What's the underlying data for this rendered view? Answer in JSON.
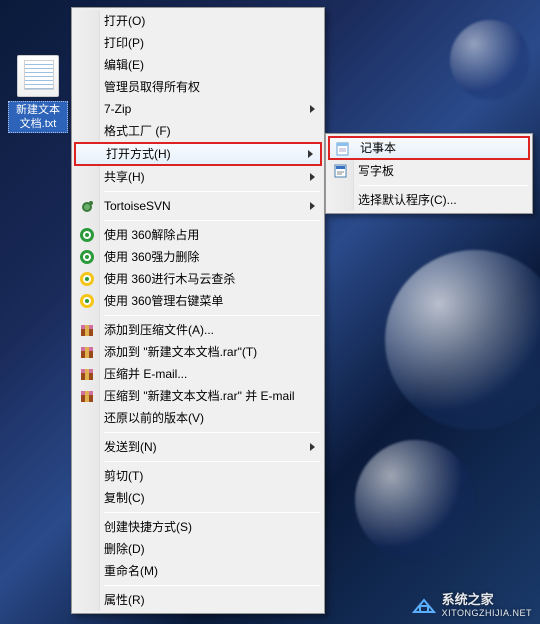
{
  "desktop": {
    "file_label": "新建文本文档.txt"
  },
  "menu": {
    "items": [
      {
        "label": "打开(O)",
        "submenu": false
      },
      {
        "label": "打印(P)",
        "submenu": false
      },
      {
        "label": "编辑(E)",
        "submenu": false
      },
      {
        "label": "管理员取得所有权",
        "submenu": false
      },
      {
        "label": "7-Zip",
        "submenu": true
      },
      {
        "label": "格式工厂 (F)",
        "submenu": false
      },
      {
        "label": "打开方式(H)",
        "submenu": true,
        "highlight": true
      },
      {
        "label": "共享(H)",
        "submenu": true
      },
      {
        "label": "TortoiseSVN",
        "submenu": true,
        "icon": "tortoise"
      },
      {
        "label": "使用 360解除占用",
        "submenu": false,
        "icon": "360"
      },
      {
        "label": "使用 360强力删除",
        "submenu": false,
        "icon": "360"
      },
      {
        "label": "使用 360进行木马云查杀",
        "submenu": false,
        "icon": "360y"
      },
      {
        "label": "使用 360管理右键菜单",
        "submenu": false,
        "icon": "360y"
      },
      {
        "label": "添加到压缩文件(A)...",
        "submenu": false,
        "icon": "rar"
      },
      {
        "label": "添加到 \"新建文本文档.rar\"(T)",
        "submenu": false,
        "icon": "rar"
      },
      {
        "label": "压缩并 E-mail...",
        "submenu": false,
        "icon": "rar"
      },
      {
        "label": "压缩到 \"新建文本文档.rar\" 并 E-mail",
        "submenu": false,
        "icon": "rar"
      },
      {
        "label": "还原以前的版本(V)",
        "submenu": false
      },
      {
        "label": "发送到(N)",
        "submenu": true
      },
      {
        "label": "剪切(T)",
        "submenu": false
      },
      {
        "label": "复制(C)",
        "submenu": false
      },
      {
        "label": "创建快捷方式(S)",
        "submenu": false
      },
      {
        "label": "删除(D)",
        "submenu": false
      },
      {
        "label": "重命名(M)",
        "submenu": false
      },
      {
        "label": "属性(R)",
        "submenu": false
      }
    ]
  },
  "submenu": {
    "items": [
      {
        "label": "记事本",
        "icon": "notepad",
        "highlight": true
      },
      {
        "label": "写字板",
        "icon": "wordpad"
      },
      {
        "label": "选择默认程序(C)..."
      }
    ]
  },
  "watermark": {
    "title": "系统之家",
    "sub": "XITONGZHIJIA.NET"
  }
}
